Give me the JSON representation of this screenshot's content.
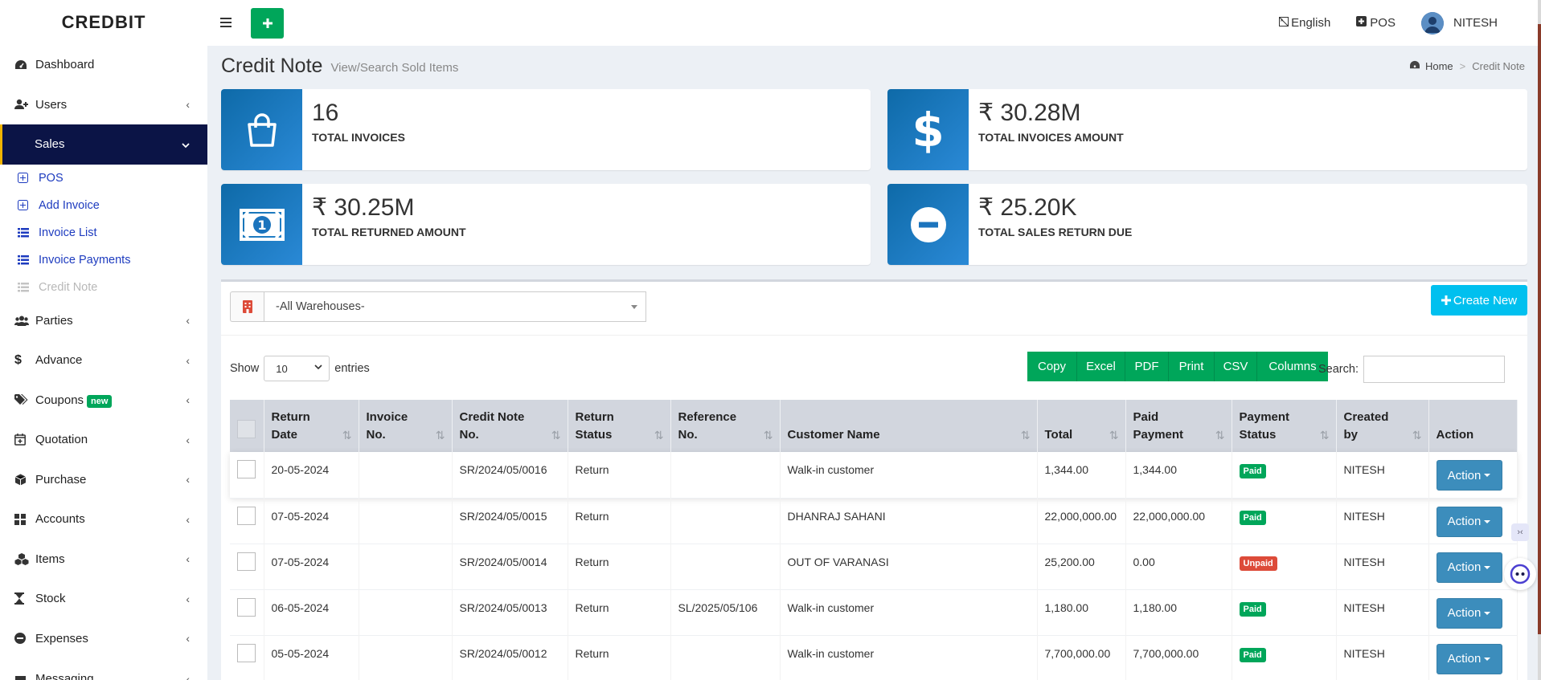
{
  "brand": "CREDBIT",
  "sidebar": {
    "items": [
      {
        "label": "Dashboard",
        "icon": "dashboard-icon"
      },
      {
        "label": "Users",
        "icon": "user-plus-icon"
      },
      {
        "label": "Sales",
        "icon": "",
        "active": true
      },
      {
        "label": "Parties",
        "icon": "users-icon"
      },
      {
        "label": "Advance",
        "icon": "dollar-icon"
      },
      {
        "label": "Coupons",
        "icon": "tags-icon",
        "badge": "new"
      },
      {
        "label": "Quotation",
        "icon": "calendar-plus-icon"
      },
      {
        "label": "Purchase",
        "icon": "cube-icon"
      },
      {
        "label": "Accounts",
        "icon": "grid-icon"
      },
      {
        "label": "Items",
        "icon": "cubes-icon"
      },
      {
        "label": "Stock",
        "icon": "hourglass-icon"
      },
      {
        "label": "Expenses",
        "icon": "minus-circle-icon"
      },
      {
        "label": "Messaging",
        "icon": "message-icon"
      }
    ],
    "sales_sub": [
      {
        "label": "POS"
      },
      {
        "label": "Add Invoice"
      },
      {
        "label": "Invoice List"
      },
      {
        "label": "Invoice Payments"
      },
      {
        "label": "Credit Note"
      }
    ]
  },
  "topbar": {
    "language": "English",
    "pos": "POS",
    "user": "NITESH"
  },
  "page": {
    "title": "Credit Note",
    "subtitle": "View/Search Sold Items",
    "breadcrumb_home": "Home",
    "breadcrumb_sep": ">",
    "breadcrumb_current": "Credit Note"
  },
  "stats": [
    {
      "value": "16",
      "label": "TOTAL INVOICES"
    },
    {
      "value": "₹ 30.28M",
      "label": "TOTAL INVOICES AMOUNT"
    },
    {
      "value": "₹ 30.25M",
      "label": "TOTAL RETURNED AMOUNT"
    },
    {
      "value": "₹ 25.20K",
      "label": "TOTAL SALES RETURN DUE"
    }
  ],
  "filters": {
    "warehouse": "-All Warehouses-",
    "create_new": "Create New",
    "show_label": "Show",
    "entries_value": "10",
    "entries_label": "entries",
    "search_label": "Search:"
  },
  "export_buttons": [
    "Copy",
    "Excel",
    "PDF",
    "Print",
    "CSV",
    "Columns"
  ],
  "table": {
    "headers": [
      "Return\nDate",
      "Invoice\nNo.",
      "Credit Note\nNo.",
      "Return\nStatus",
      "Reference\nNo.",
      "Customer Name",
      "Total",
      "Paid\nPayment",
      "Payment\nStatus",
      "Created\nby",
      "Action"
    ],
    "rows": [
      {
        "date": "20-05-2024",
        "invoice": "",
        "credit_note": "SR/2024/05/0016",
        "status": "Return",
        "reference": "",
        "customer": "Walk-in customer",
        "total": "1,344.00",
        "paid": "1,344.00",
        "payment_status": "Paid",
        "created_by": "NITESH",
        "action": "Action"
      },
      {
        "date": "07-05-2024",
        "invoice": "",
        "credit_note": "SR/2024/05/0015",
        "status": "Return",
        "reference": "",
        "customer": "DHANRAJ SAHANI",
        "total": "22,000,000.00",
        "paid": "22,000,000.00",
        "payment_status": "Paid",
        "created_by": "NITESH",
        "action": "Action"
      },
      {
        "date": "07-05-2024",
        "invoice": "",
        "credit_note": "SR/2024/05/0014",
        "status": "Return",
        "reference": "",
        "customer": "OUT OF VARANASI",
        "total": "25,200.00",
        "paid": "0.00",
        "payment_status": "Unpaid",
        "created_by": "NITESH",
        "action": "Action"
      },
      {
        "date": "06-05-2024",
        "invoice": "",
        "credit_note": "SR/2024/05/0013",
        "status": "Return",
        "reference": "SL/2025/05/106",
        "customer": "Walk-in customer",
        "total": "1,180.00",
        "paid": "1,180.00",
        "payment_status": "Paid",
        "created_by": "NITESH",
        "action": "Action"
      },
      {
        "date": "05-05-2024",
        "invoice": "",
        "credit_note": "SR/2024/05/0012",
        "status": "Return",
        "reference": "",
        "customer": "Walk-in customer",
        "total": "7,700,000.00",
        "paid": "7,700,000.00",
        "payment_status": "Paid",
        "created_by": "NITESH",
        "action": "Action"
      }
    ]
  },
  "colors": {
    "sidebar_active": "#0b1446",
    "accent_green": "#00a65a",
    "accent_cyan": "#00c0ef",
    "action_blue": "#3c8dbc",
    "unpaid_red": "#dd4b39"
  }
}
